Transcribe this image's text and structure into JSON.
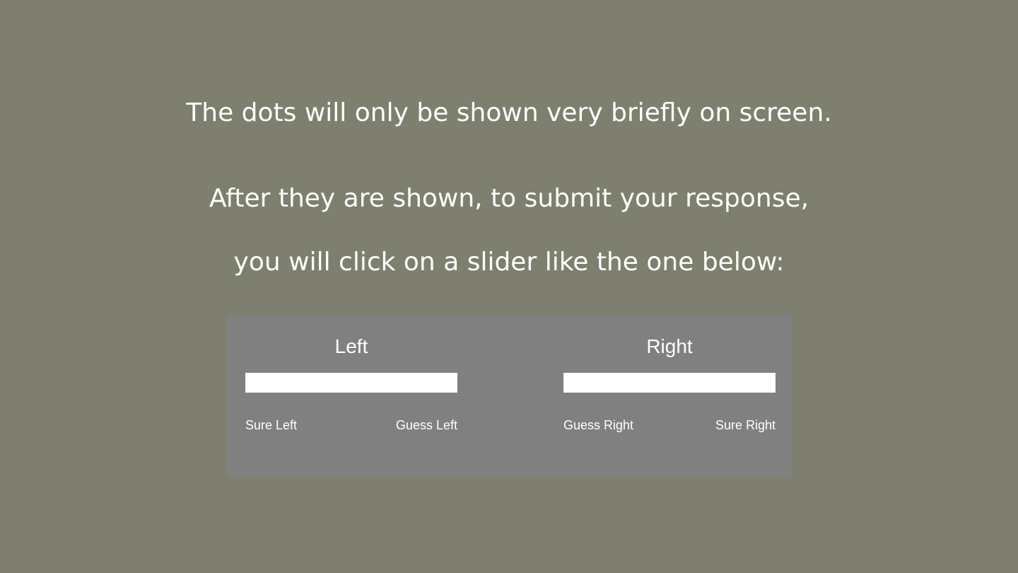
{
  "instructions": {
    "line1": "The dots will only be shown very briefly on screen.",
    "line2": "After they are shown, to submit your response,",
    "line3": "you will click on a slider like the one below:"
  },
  "slider_panel": {
    "left": {
      "title": "Left",
      "label_start": "Sure Left",
      "label_end": "Guess Left"
    },
    "right": {
      "title": "Right",
      "label_start": "Guess Right",
      "label_end": "Sure Right"
    }
  },
  "colors": {
    "background": "#7f7f6f",
    "panel": "#808080",
    "track": "#ffffff",
    "text": "#ffffff"
  }
}
